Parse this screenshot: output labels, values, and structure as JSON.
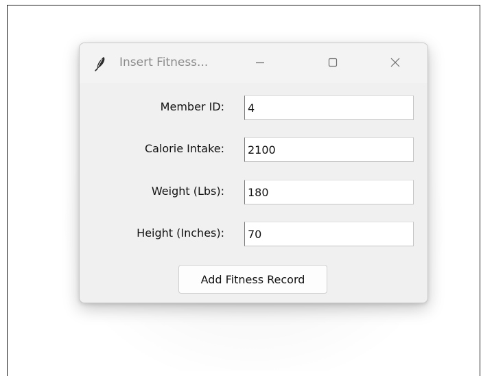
{
  "window": {
    "title": "Insert Fitness...",
    "controls": {
      "minimize_icon": "minimize-icon",
      "maximize_icon": "maximize-icon",
      "close_icon": "close-icon"
    },
    "app_icon": "feather-icon"
  },
  "form": {
    "fields": [
      {
        "label": "Member ID:",
        "value": "4"
      },
      {
        "label": "Calorie Intake:",
        "value": "2100"
      },
      {
        "label": "Weight (Lbs):",
        "value": "180"
      },
      {
        "label": "Height (Inches):",
        "value": "70"
      }
    ],
    "submit_label": "Add Fitness Record"
  },
  "colors": {
    "window_bg": "#f0f0f0",
    "title_text": "#8a8a8a",
    "text": "#111111"
  }
}
